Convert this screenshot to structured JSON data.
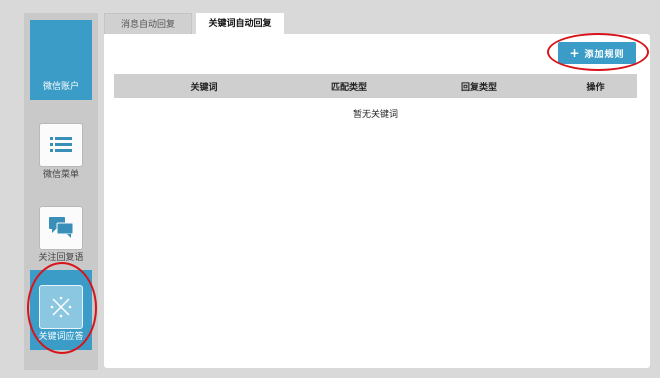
{
  "sidebar": {
    "items": [
      {
        "label": "微信账户",
        "icon": "wechat-account-icon",
        "active": true
      },
      {
        "label": "微信菜单",
        "icon": "list-menu-icon",
        "active": false
      },
      {
        "label": "关注回复语",
        "icon": "chat-bubbles-icon",
        "active": false
      },
      {
        "label": "关键词应答",
        "icon": "keyword-icon",
        "active": true
      }
    ]
  },
  "tabs": [
    {
      "label": "消息自动回复",
      "active": false
    },
    {
      "label": "关键词自动回复",
      "active": true
    }
  ],
  "toolbar": {
    "add_label": "添加规则",
    "add_icon": "plus-icon"
  },
  "table": {
    "columns": [
      "关键词",
      "匹配类型",
      "回复类型",
      "操作"
    ],
    "empty_text": "暂无关键词"
  },
  "colors": {
    "accent": "#3a9cc7",
    "highlight_ring": "#d8141b"
  }
}
